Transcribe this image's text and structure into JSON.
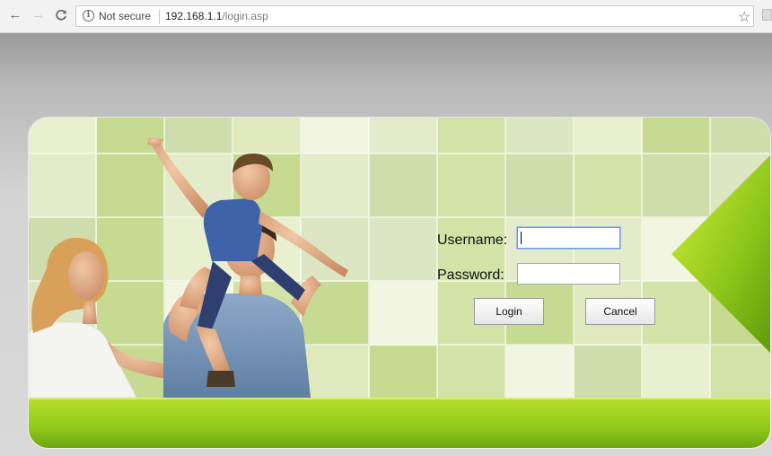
{
  "browser": {
    "back_icon": "arrow-left-icon",
    "forward_icon": "arrow-right-icon",
    "reload_icon": "reload-icon",
    "security_icon": "info-icon",
    "security_text": "Not secure",
    "url_host": "192.168.1.1",
    "url_path": "/login.asp",
    "bookmark_icon": "star-icon"
  },
  "login": {
    "username_label": "Username:",
    "username_value": "",
    "password_label": "Password:",
    "password_value": "",
    "login_button": "Login",
    "cancel_button": "Cancel"
  },
  "theme": {
    "accent_green": "#91c91a",
    "tile_green": "#c9df9c",
    "focus_blue": "#6b9bd6"
  }
}
